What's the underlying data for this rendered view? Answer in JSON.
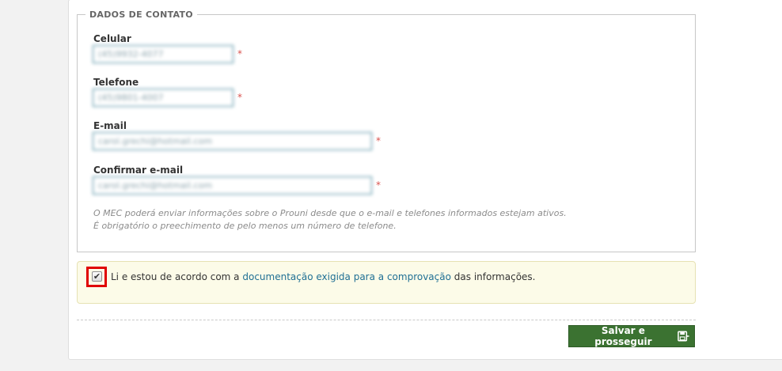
{
  "contact_section": {
    "legend": "DADOS DE CONTATO",
    "fields": {
      "celular": {
        "label": "Celular",
        "value": "(45)9932-4077"
      },
      "telefone": {
        "label": "Telefone",
        "value": "(45)9801-4007"
      },
      "email": {
        "label": "E-mail",
        "value": "carol.grechi@hotmail.com"
      },
      "confirm_email": {
        "label": "Confirmar e-mail",
        "value": "carol.grechi@hotmail.com"
      }
    },
    "required_marker": "*",
    "notes": [
      "O MEC poderá enviar informações sobre o Prouni desde que o e-mail e telefones informados estejam ativos.",
      "É obrigatório o preechimento de pelo menos um número de telefone."
    ]
  },
  "agreement": {
    "checked": true,
    "check_glyph": "✔",
    "text_before": "Li e estou de acordo com a ",
    "link_text": "documentação exigida para a comprovação",
    "text_after": " das informações."
  },
  "actions": {
    "save_label": "Salvar e prosseguir",
    "save_icon": "floppy-disk-arrow-icon"
  },
  "colors": {
    "field_border": "#2f7891",
    "required": "#d9534f",
    "link": "#1f6f94",
    "button": "#3b7231",
    "highlight": "#e00000"
  }
}
